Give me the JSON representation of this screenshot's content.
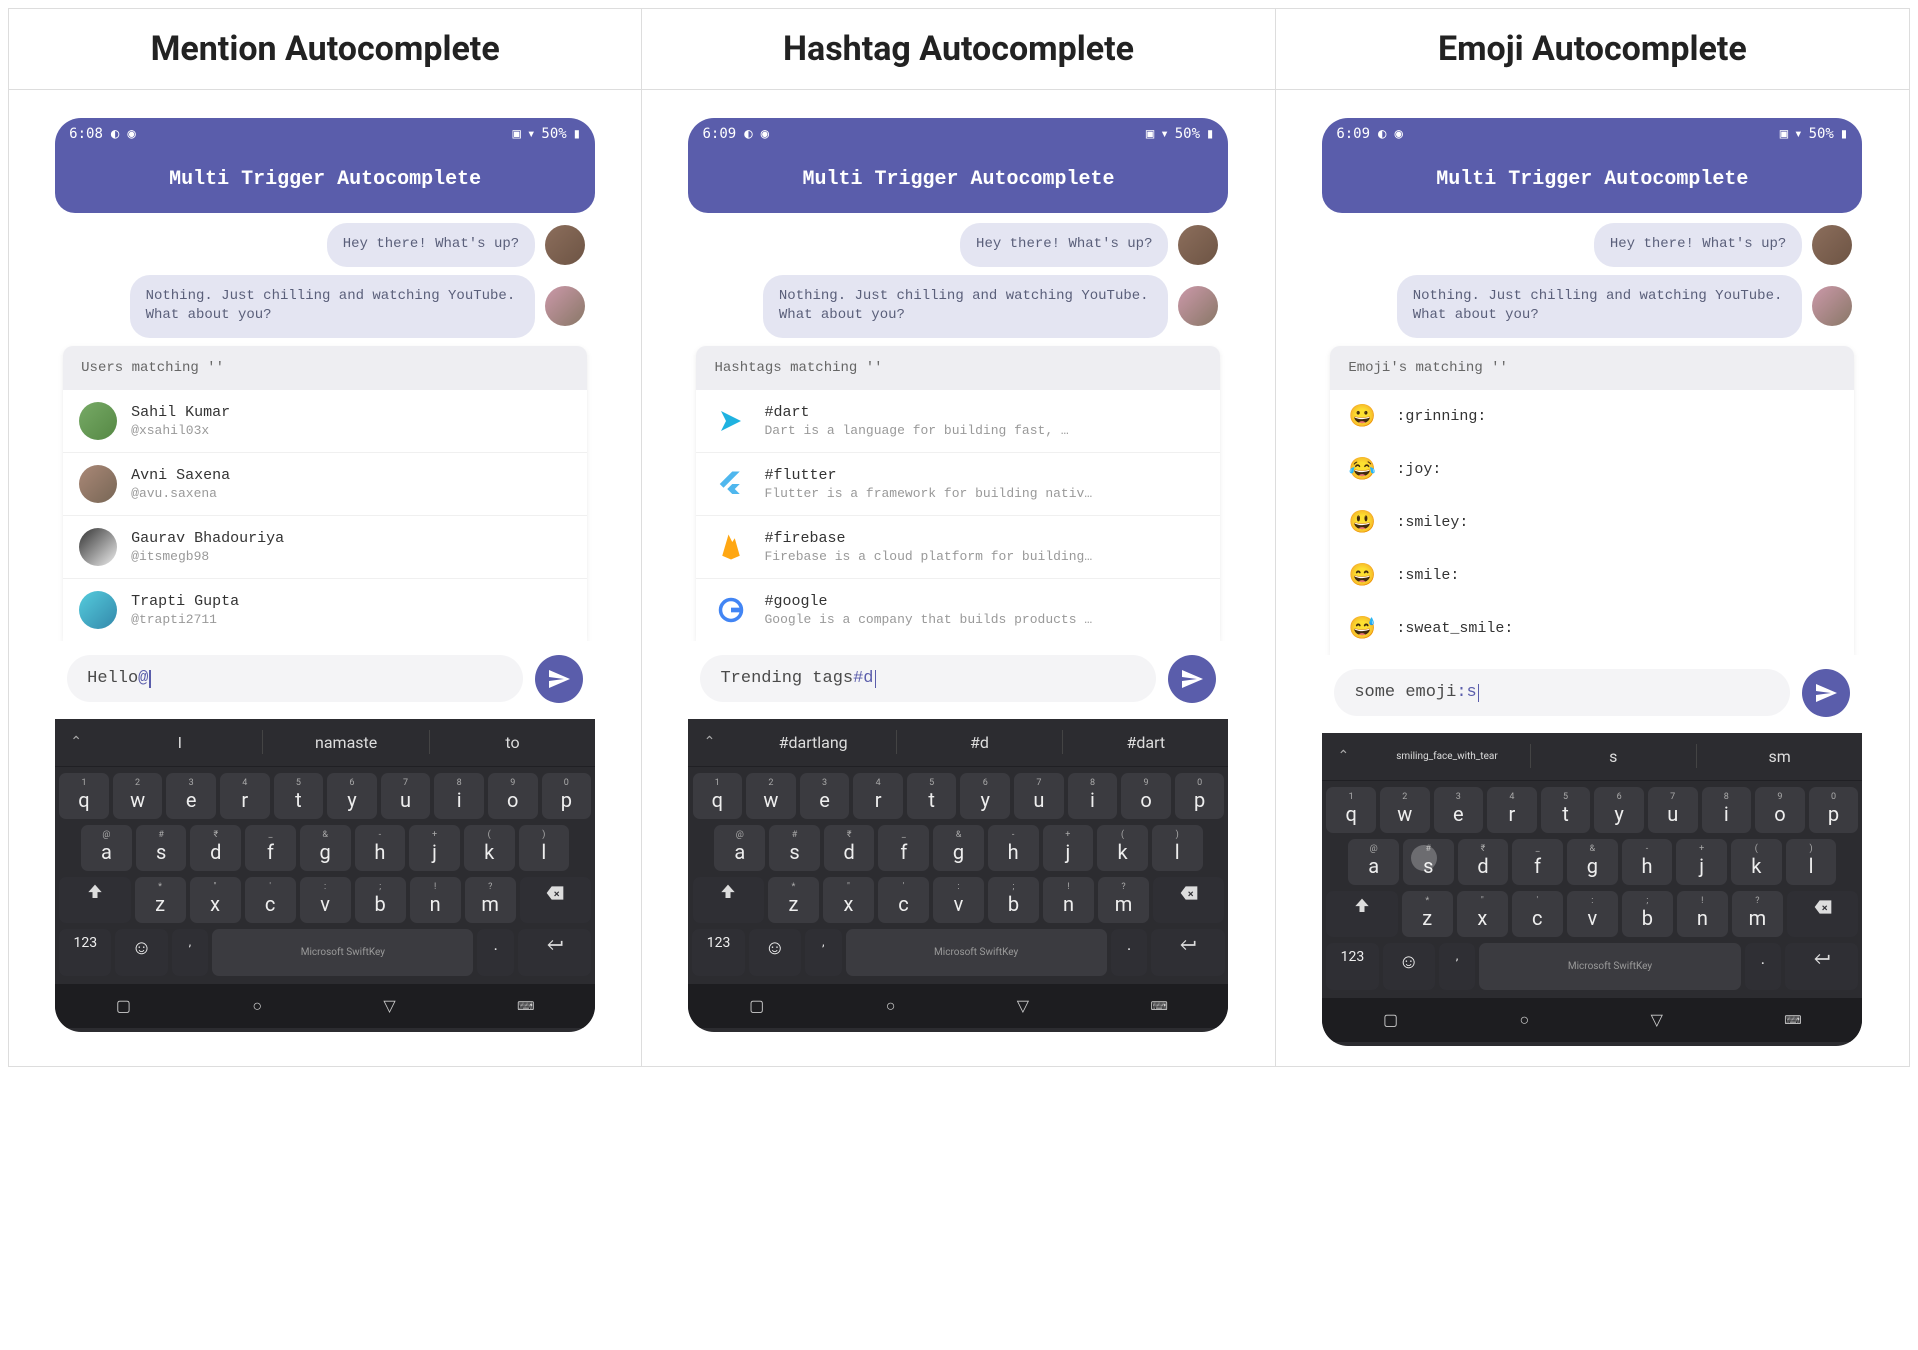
{
  "columns": [
    {
      "title": "Mention Autocomplete"
    },
    {
      "title": "Hashtag Autocomplete"
    },
    {
      "title": "Emoji Autocomplete"
    }
  ],
  "status": {
    "time1": "6:08",
    "time2": "6:09",
    "time3": "6:09",
    "battery": "50%"
  },
  "appbar": {
    "title": "Multi Trigger Autocomplete"
  },
  "chat": {
    "msg1": "Hey there! What's up?",
    "msg2": "Nothing. Just chilling and watching YouTube. What about you?"
  },
  "mention": {
    "header": "Users matching ''",
    "items": [
      {
        "name": "Sahil Kumar",
        "handle": "@xsahil03x"
      },
      {
        "name": "Avni Saxena",
        "handle": "@avu.saxena"
      },
      {
        "name": "Gaurav Bhadouriya",
        "handle": "@itsmegb98"
      },
      {
        "name": "Trapti Gupta",
        "handle": "@trapti2711"
      }
    ],
    "input_plain": "Hello ",
    "input_hl": "@",
    "sugg": [
      "I",
      "namaste",
      "to"
    ]
  },
  "hashtag": {
    "header": "Hashtags matching ''",
    "items": [
      {
        "name": "#dart",
        "desc": "Dart is a language for building fast, …",
        "color": "#1fb2e0"
      },
      {
        "name": "#flutter",
        "desc": "Flutter is a framework for building nativ…",
        "color": "#4fb7ee"
      },
      {
        "name": "#firebase",
        "desc": "Firebase is a cloud platform for building…",
        "color": "#ffa713"
      },
      {
        "name": "#google",
        "desc": "Google is a company that builds products …",
        "color": "#4285f4"
      }
    ],
    "input_plain": "Trending tags ",
    "input_hl": "#d",
    "sugg": [
      "#dartlang",
      "#d",
      "#dart"
    ]
  },
  "emoji": {
    "header": "Emoji's matching ''",
    "items": [
      {
        "glyph": "😀",
        "code": ":grinning:"
      },
      {
        "glyph": "😂",
        "code": ":joy:"
      },
      {
        "glyph": "😃",
        "code": ":smiley:"
      },
      {
        "glyph": "😄",
        "code": ":smile:"
      },
      {
        "glyph": "😅",
        "code": ":sweat_smile:"
      }
    ],
    "input_plain": "some emoji ",
    "input_hl": ":s",
    "sugg": [
      "smiling_face_with_tear",
      "s",
      "sm"
    ]
  },
  "keyboard": {
    "row1": [
      [
        "1",
        "q"
      ],
      [
        "2",
        "w"
      ],
      [
        "3",
        "e"
      ],
      [
        "4",
        "r"
      ],
      [
        "5",
        "t"
      ],
      [
        "6",
        "y"
      ],
      [
        "7",
        "u"
      ],
      [
        "8",
        "i"
      ],
      [
        "9",
        "o"
      ],
      [
        "0",
        "p"
      ]
    ],
    "row2": [
      [
        "@",
        "a"
      ],
      [
        "#",
        "s"
      ],
      [
        "₹",
        "d"
      ],
      [
        "_",
        "f"
      ],
      [
        "&",
        "g"
      ],
      [
        "-",
        "h"
      ],
      [
        "+",
        "j"
      ],
      [
        "(",
        "k"
      ],
      [
        ")",
        "l"
      ]
    ],
    "row3": [
      [
        "*",
        "z"
      ],
      [
        "\"",
        "x"
      ],
      [
        "'",
        "c"
      ],
      [
        ":",
        "v"
      ],
      [
        ";",
        "b"
      ],
      [
        "!",
        "n"
      ],
      [
        "?",
        "m"
      ]
    ],
    "brand": "Microsoft SwiftKey",
    "numkey": "123"
  }
}
